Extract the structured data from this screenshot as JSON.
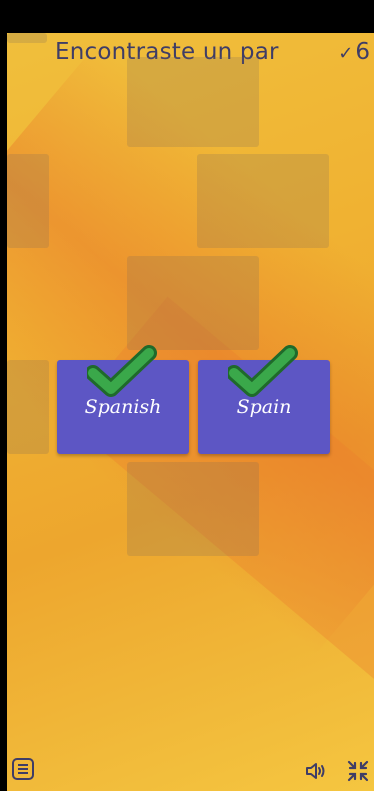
{
  "header": {
    "title": "Encontraste un par",
    "score_check": "✓",
    "score_value": "6"
  },
  "cards": [
    {
      "label": "Spanish",
      "matched": true
    },
    {
      "label": "Spain",
      "matched": true
    }
  ],
  "colors": {
    "card": "#5d56c4",
    "check_fill": "#3aa84a",
    "check_outline": "#1f6a2b",
    "title_text": "#3f3d66"
  },
  "toolbar": {
    "menu_icon": "menu-icon",
    "sound_icon": "speaker-icon",
    "collapse_icon": "collapse-icon"
  }
}
